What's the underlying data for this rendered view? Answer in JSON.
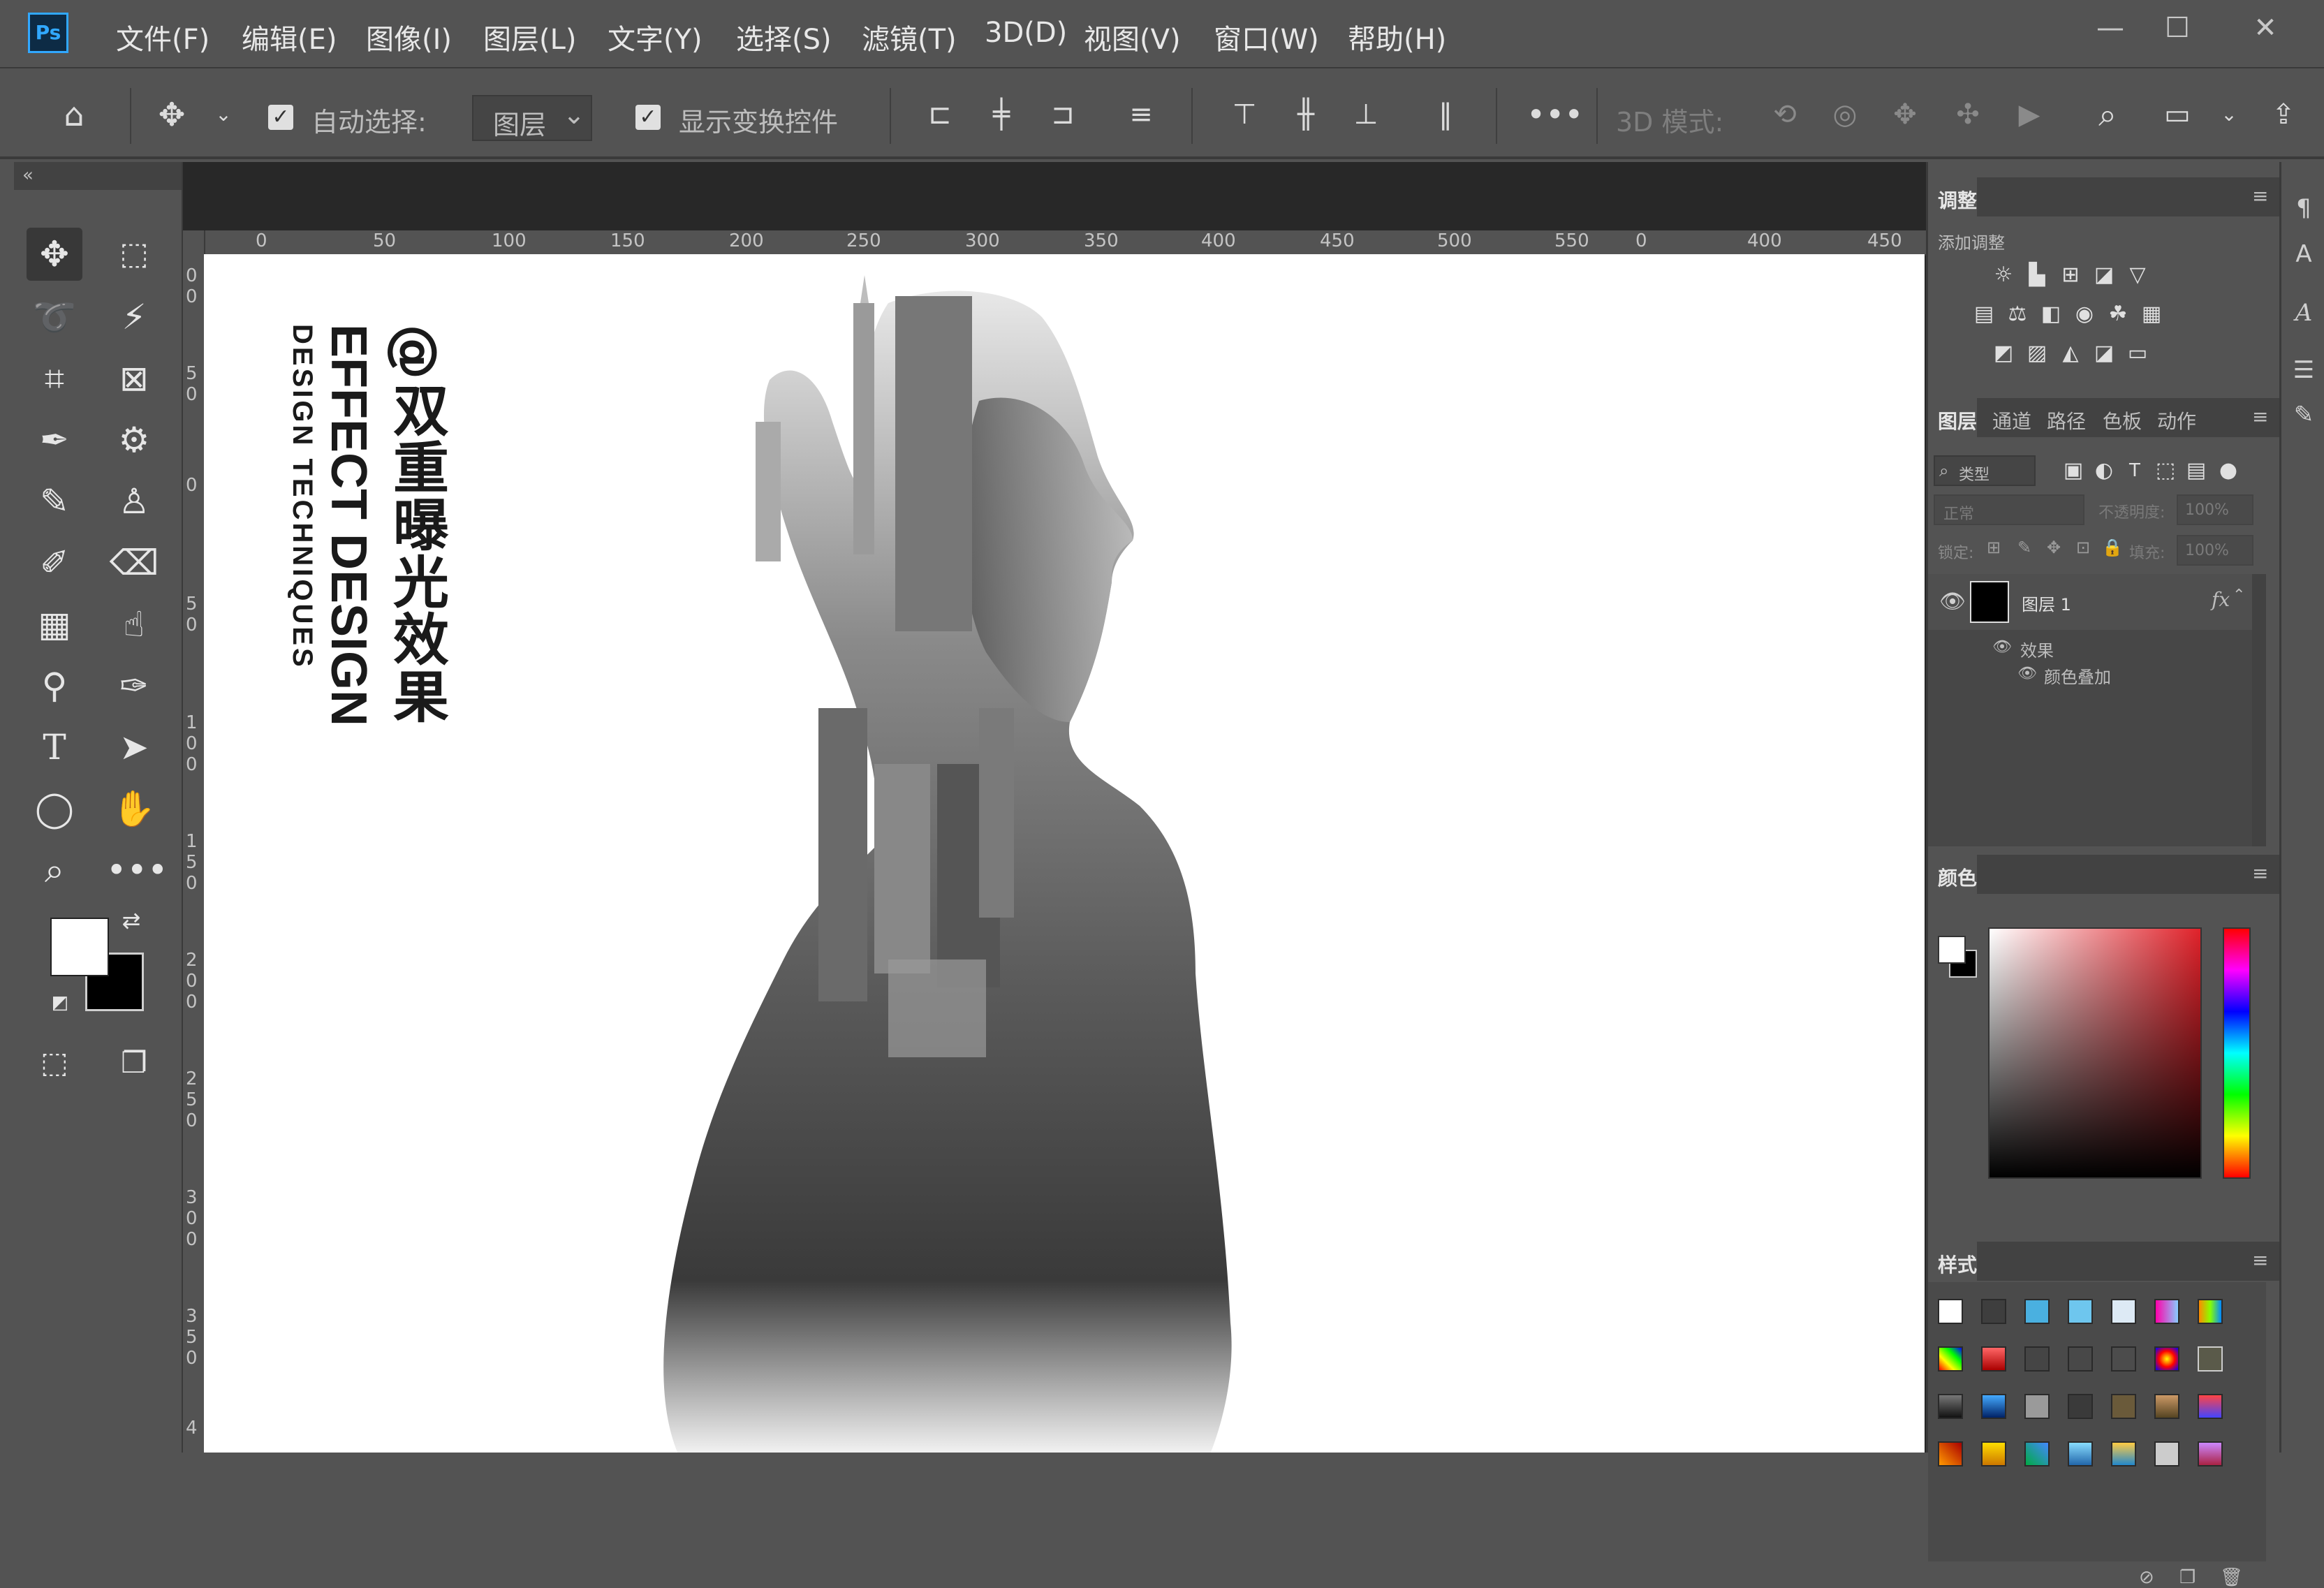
{
  "app": {
    "logo": "Ps"
  },
  "menu": [
    "文件(F)",
    "编辑(E)",
    "图像(I)",
    "图层(L)",
    "文字(Y)",
    "选择(S)",
    "滤镜(T)",
    "3D(D)",
    "视图(V)",
    "窗口(W)",
    "帮助(H)"
  ],
  "window_controls": {
    "minimize": "—",
    "maximize": "☐",
    "close": "✕"
  },
  "options": {
    "auto_select_label": "自动选择:",
    "auto_select_target": "图层",
    "show_transform_label": "显示变换控件",
    "mode_3d_label": "3D 模式:"
  },
  "ruler_top": [
    "0",
    "50",
    "100",
    "150",
    "200",
    "250",
    "300",
    "350",
    "400",
    "450",
    "500",
    "550",
    "0",
    "400",
    "450"
  ],
  "ruler_left": [
    "0",
    "0",
    "5",
    "0",
    "0",
    "5",
    "0",
    "1",
    "0",
    "0",
    "1",
    "5",
    "0",
    "2",
    "0",
    "0",
    "2",
    "5",
    "0",
    "3",
    "0",
    "0",
    "3",
    "5",
    "0",
    "4"
  ],
  "document": {
    "title_cn": "@双重曝光效果",
    "title_en": "EFFECT DESIGN",
    "subtitle_en": "DESIGN TECHNIQUES"
  },
  "adjustments": {
    "tab": "调整",
    "add_label": "添加调整"
  },
  "layers_panel": {
    "tabs": [
      "图层",
      "通道",
      "路径",
      "色板",
      "动作"
    ],
    "filter_kind": "类型",
    "blend_mode": "正常",
    "opacity_label": "不透明度:",
    "opacity_value": "100%",
    "lock_label": "锁定:",
    "fill_label": "填充:",
    "fill_value": "100%",
    "layer_name": "图层 1",
    "fx": "fx",
    "effects_label": "效果",
    "effect_item": "颜色叠加"
  },
  "color_panel": {
    "tab": "颜色"
  },
  "styles_panel": {
    "tab": "样式"
  },
  "colors": {
    "ui_bg": "#535353",
    "ui_dark": "#424242",
    "canvas_bg": "#282828",
    "ps_accent": "#31a8ff",
    "foreground": "#ffffff",
    "background": "#000000",
    "picker_hue": "#e0222a"
  }
}
